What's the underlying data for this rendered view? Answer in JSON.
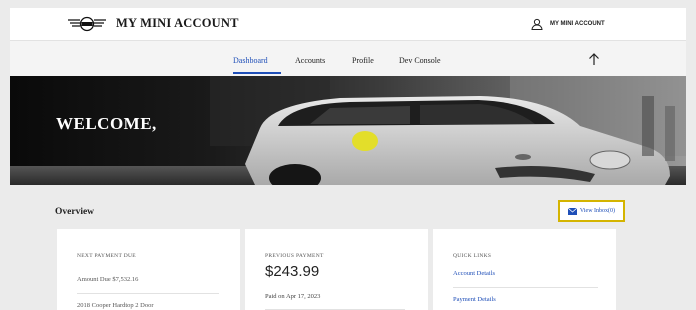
{
  "header": {
    "brand": "MY MINI ACCOUNT",
    "account_label": "MY MINI ACCOUNT",
    "logo_icon": "mini-wings-logo",
    "user_icon": "user-icon"
  },
  "nav": {
    "items": [
      {
        "label": "Dashboard",
        "active": true
      },
      {
        "label": "Accounts",
        "active": false
      },
      {
        "label": "Profile",
        "active": false
      },
      {
        "label": "Dev Console",
        "active": false
      }
    ],
    "scroll_icon": "arrow-up-icon"
  },
  "hero": {
    "title": "WELCOME,"
  },
  "overview": {
    "title": "Overview",
    "inbox_label": "View Inbox(0)",
    "inbox_icon": "envelope-icon"
  },
  "cards": {
    "next_payment": {
      "title": "NEXT PAYMENT DUE",
      "amount_due": "Amount Due $7,532.16",
      "vehicle": "2018 Cooper Hardtop 2 Door"
    },
    "previous_payment": {
      "title": "PREVIOUS PAYMENT",
      "amount": "$243.99",
      "paid_on": "Paid on Apr 17, 2023"
    },
    "quick_links": {
      "title": "QUICK LINKS",
      "links": [
        "Account Details",
        "Payment Details"
      ]
    }
  },
  "colors": {
    "accent": "#1f4fb8",
    "highlight": "#d4b400",
    "car_yellow": "#e3de2a"
  }
}
